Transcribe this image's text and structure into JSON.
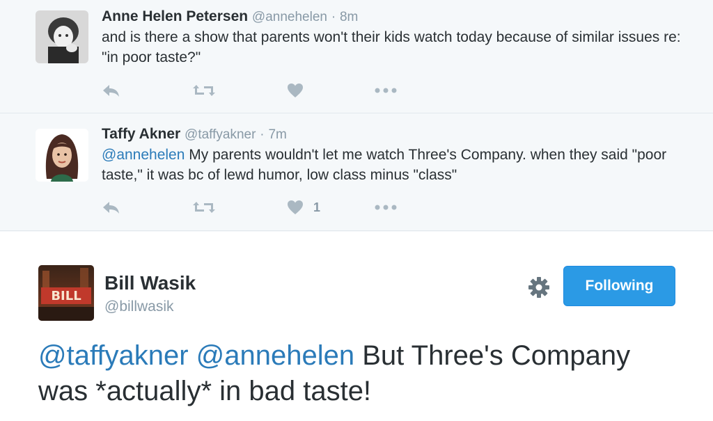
{
  "tweets": [
    {
      "name": "Anne Helen Petersen",
      "handle": "@annehelen",
      "separator": "·",
      "time": "8m",
      "mention": "",
      "body": "and is there a show that parents won't their kids watch today because of similar issues re: \"in poor taste?\"",
      "like_count": ""
    },
    {
      "name": "Taffy Akner",
      "handle": "@taffyakner",
      "separator": "·",
      "time": "7m",
      "mention": "@annehelen",
      "body": " My parents wouldn't let me watch Three's Company. when they said \"poor taste,\" it was bc of lewd humor, low class minus \"class\"",
      "like_count": "1"
    }
  ],
  "main_tweet": {
    "name": "Bill Wasik",
    "handle": "@billwasik",
    "follow_label": "Following",
    "mention1": "@taffyakner",
    "mention2": "@annehelen",
    "body": " But Three's Company was *actually* in bad taste!",
    "avatar_text": "BILL"
  },
  "icons": [
    "reply-icon",
    "retweet-icon",
    "heart-icon",
    "more-icon",
    "gear-icon"
  ],
  "colors": {
    "background": "#f5f8fa",
    "text": "#292f33",
    "muted": "#8899a6",
    "link": "#2b7bb9",
    "button": "#2b9ae5"
  }
}
